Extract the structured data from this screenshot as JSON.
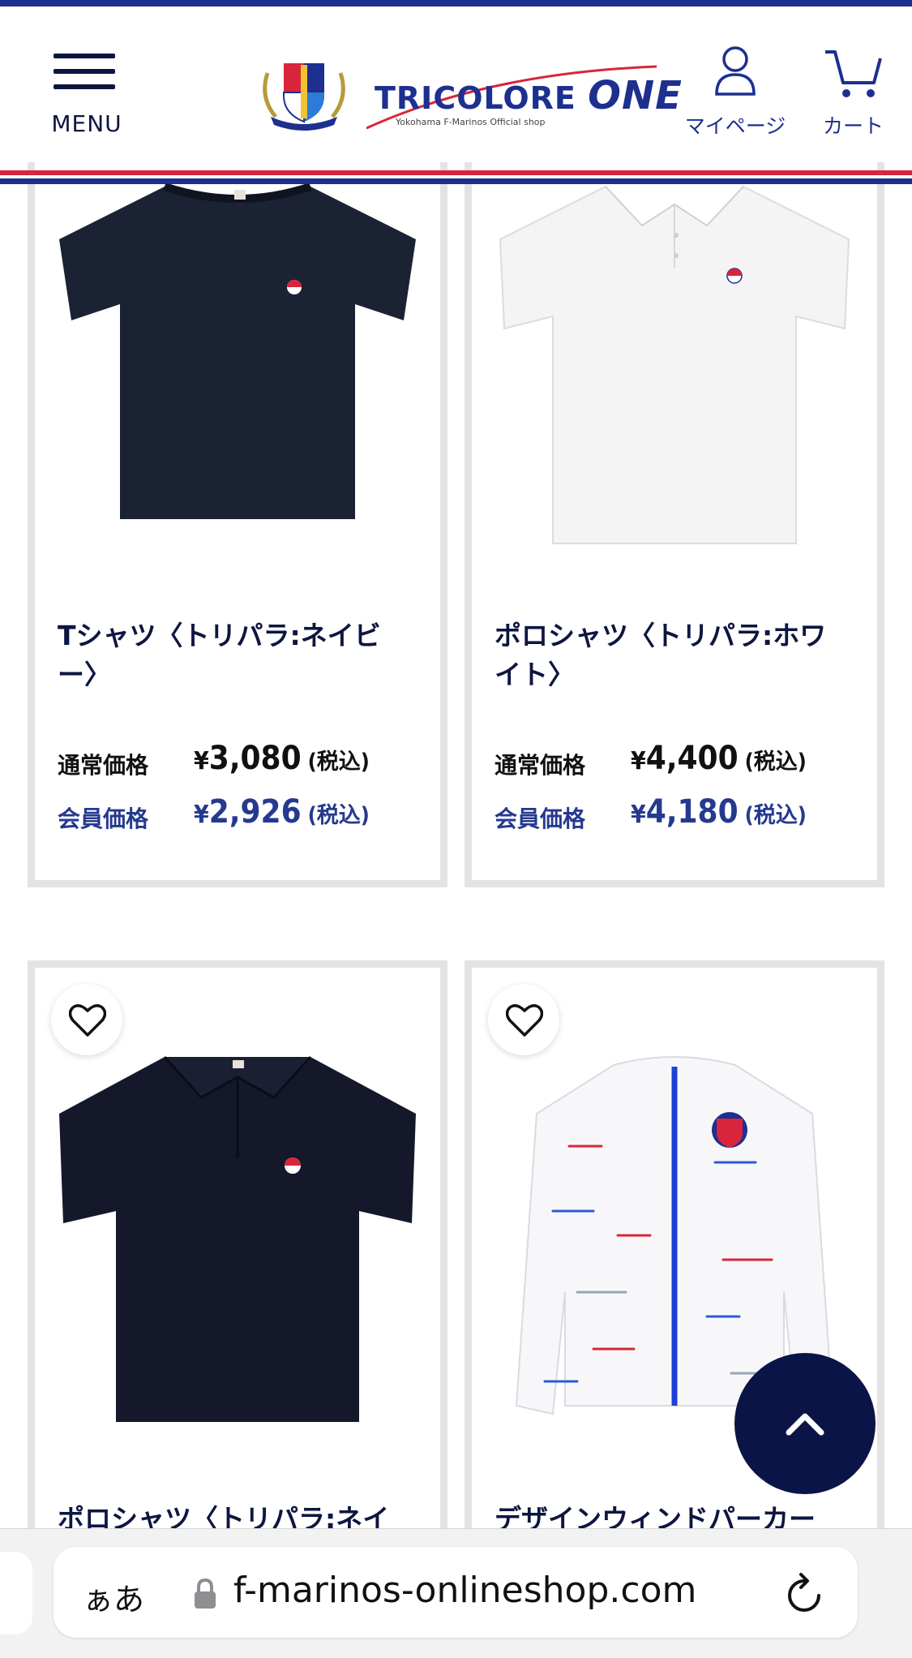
{
  "header": {
    "menu_label": "MENU",
    "logo_title_prefix": "TRICOLORE",
    "logo_title_suffix": "ONE",
    "logo_subtitle": "Yokohama F-Marinos   Official shop",
    "mypage_label": "マイページ",
    "cart_label": "カート",
    "colors": {
      "navy": "#0d1640",
      "brand_blue": "#1d2f8f",
      "brand_red": "#d8253c"
    }
  },
  "products": [
    {
      "name": "Tシャツ〈トリパラ:ネイビー〉",
      "regular_label": "通常価格",
      "regular_price": "3,080",
      "member_label": "会員価格",
      "member_price": "2,926",
      "currency": "¥",
      "tax_note": "(税込)",
      "image": "navy-tshirt"
    },
    {
      "name": "ポロシャツ〈トリパラ:ホワイト〉",
      "regular_label": "通常価格",
      "regular_price": "4,400",
      "member_label": "会員価格",
      "member_price": "4,180",
      "currency": "¥",
      "tax_note": "(税込)",
      "image": "white-polo"
    },
    {
      "name": "ポロシャツ〈トリパラ:ネイ",
      "image": "navy-polo"
    },
    {
      "name": "デザインウィンドパーカー",
      "image": "white-windbreaker"
    }
  ],
  "browser": {
    "aa_label": "ぁあ",
    "url": "f-marinos-onlineshop.com"
  },
  "icons": [
    "hamburger-icon",
    "person-icon",
    "cart-icon",
    "heart-icon",
    "chevron-up-icon",
    "lock-icon",
    "reload-icon"
  ]
}
